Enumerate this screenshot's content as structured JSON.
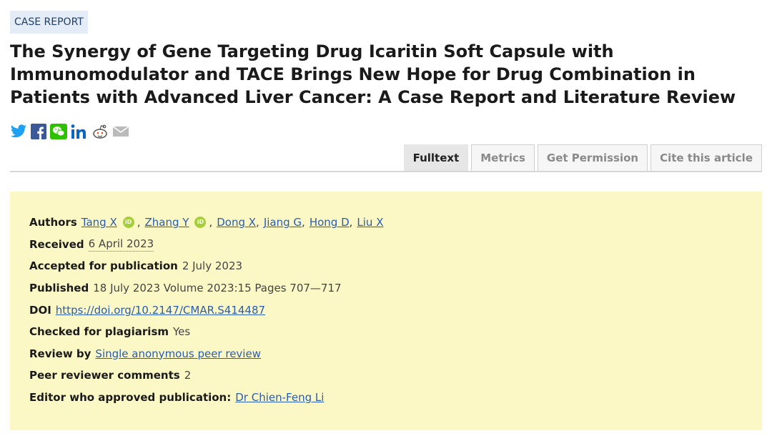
{
  "article_type": "CASE REPORT",
  "title": "The Synergy of Gene Targeting Drug Icaritin Soft Capsule with Immunomodulator and TACE Brings New Hope for Drug Combination in Patients with Advanced Liver Cancer: A Case Report and Literature Review",
  "share_icons": [
    "twitter-icon",
    "facebook-icon",
    "wechat-icon",
    "linkedin-icon",
    "reddit-icon",
    "email-icon"
  ],
  "tabs": [
    "Fulltext",
    "Metrics",
    "Get Permission",
    "Cite this article"
  ],
  "active_tab": "Fulltext",
  "meta": {
    "authors_label": "Authors",
    "authors": [
      "Tang X",
      "Zhang Y",
      "Dong X",
      "Jiang G",
      "Hong D",
      "Liu X"
    ],
    "orcid_text": "iD",
    "received_label": "Received",
    "received": "6 April 2023",
    "accepted_label": "Accepted for publication",
    "accepted": "2 July 2023",
    "published_label": "Published",
    "published": "18 July 2023 Volume 2023:15 Pages 707—717",
    "doi_label": "DOI",
    "doi": "https://doi.org/10.2147/CMAR.S414487",
    "plagiarism_label": "Checked for plagiarism",
    "plagiarism": "Yes",
    "review_label": "Review by",
    "review": "Single anonymous peer review",
    "peer_comments_label": "Peer reviewer comments",
    "peer_comments": "2",
    "editor_label": "Editor who approved publication:",
    "editor": "Dr Chien-Feng Li"
  },
  "colors": {
    "panel_bg": "#fbf8c6",
    "link": "#2a5db0",
    "badge_bg": "#e3ecf7",
    "orcid": "#a6ce39",
    "twitter": "#1da1f2",
    "facebook": "#3b5998",
    "wechat": "#2dc100",
    "linkedin": "#0a66c2"
  }
}
